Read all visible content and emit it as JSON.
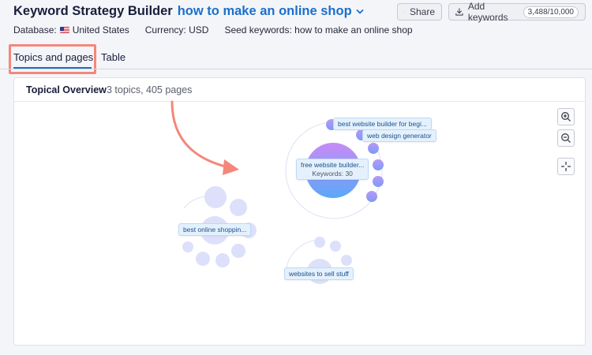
{
  "header": {
    "app_title": "Keyword Strategy Builder",
    "project_name": "how to make an online shop",
    "share_label": "Share",
    "add_keywords_label": "Add keywords",
    "keywords_counter": "3,488/10,000"
  },
  "meta": {
    "database_label": "Database:",
    "database_value": "United States",
    "currency": "Currency: USD",
    "seed_keywords": "Seed keywords: how to make an online shop"
  },
  "tabs": [
    {
      "label": "Topics and pages",
      "active": true
    },
    {
      "label": "Table",
      "active": false
    }
  ],
  "panel": {
    "title": "Topical Overview",
    "subtitle": "3 topics, 405 pages"
  },
  "clusters": {
    "main_label": "free website builder...",
    "main_keywords": "Keywords: 30",
    "page_label_1": "best website builder for begi...",
    "page_label_2": "web design generator",
    "cluster2_label": "best online shoppin...",
    "cluster3_label": "websites to sell stuff"
  },
  "icons": {
    "share": "share-users-icon",
    "add": "download-icon",
    "zoom_in": "zoom-in-icon",
    "zoom_out": "zoom-out-icon",
    "fit": "fit-center-icon",
    "chevron": "chevron-down-icon"
  },
  "colors": {
    "accent": "#1b6fcc",
    "highlight": "#f4877a",
    "bubble_light": "#d8dcf9",
    "bubble_main_top": "#c78bf5",
    "bubble_main_bottom": "#5aa8f8"
  }
}
